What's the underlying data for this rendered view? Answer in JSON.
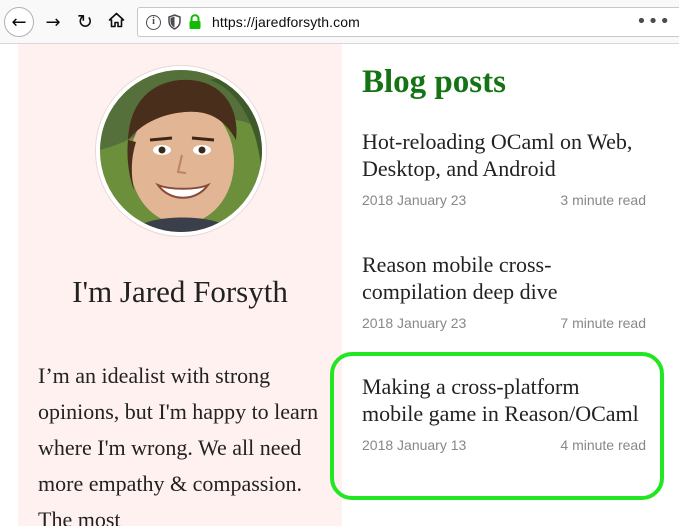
{
  "browser": {
    "url": "https://jaredforsyth.com",
    "buttons": {
      "back_icon": "back-arrow-icon",
      "forward_icon": "forward-arrow-icon",
      "reload_icon": "reload-icon",
      "home_icon": "home-icon"
    }
  },
  "profile": {
    "name": "I'm Jared Forsyth",
    "bio": "I’m an idealist with strong opinions, but I'm happy to learn where I'm wrong. We all need more empathy & compassion. The most",
    "background_color": "#fff1ef"
  },
  "blog": {
    "heading": "Blog posts",
    "heading_color": "#147314",
    "posts": [
      {
        "title": "Hot-reloading OCaml on Web, Desktop, and Android",
        "date": "2018 January 23",
        "read_time": "3 minute read"
      },
      {
        "title": "Reason mobile cross-compilation deep dive",
        "date": "2018 January 23",
        "read_time": "7 minute read"
      },
      {
        "title": "Making a cross-platform mobile game in Reason/OCaml",
        "date": "2018 January 13",
        "read_time": "4 minute read"
      }
    ]
  },
  "highlight_color": "#22e622"
}
